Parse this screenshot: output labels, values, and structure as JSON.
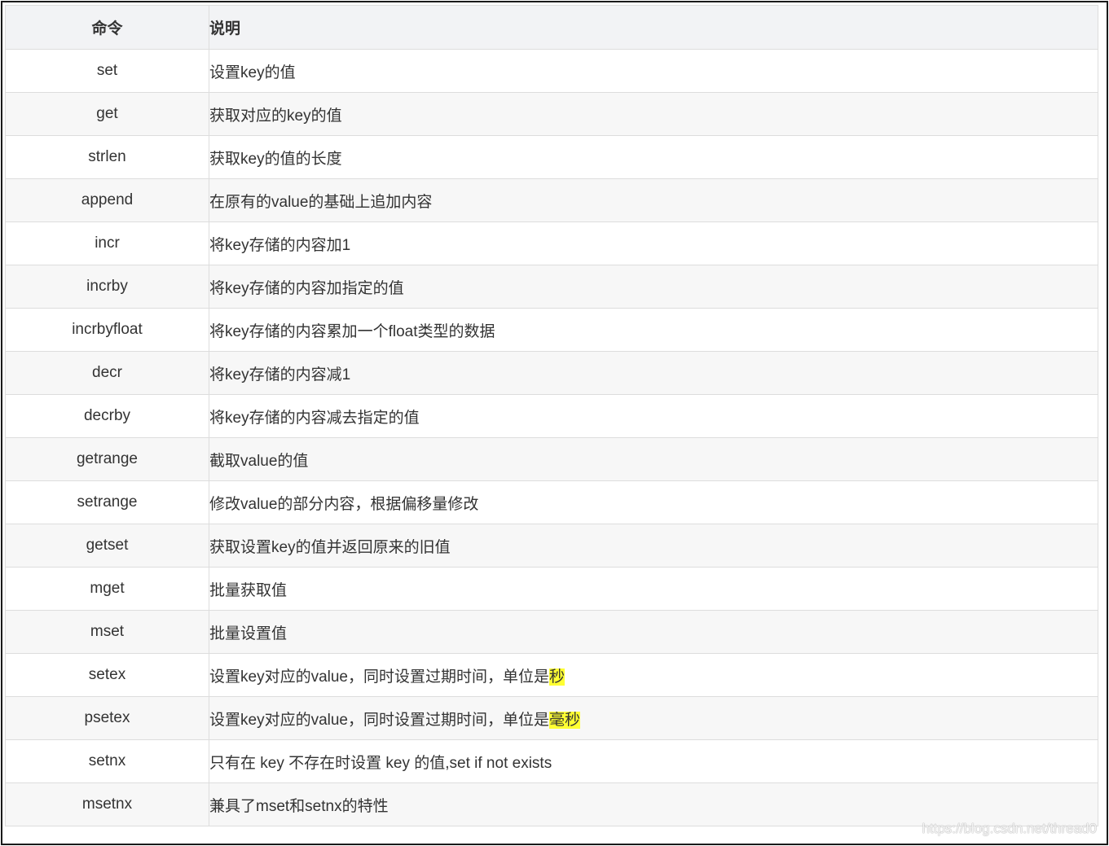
{
  "table": {
    "headers": {
      "command": "命令",
      "description": "说明"
    },
    "rows": [
      {
        "cmd": "set",
        "desc": "设置key的值",
        "hl": ""
      },
      {
        "cmd": "get",
        "desc": "获取对应的key的值",
        "hl": ""
      },
      {
        "cmd": "strlen",
        "desc": "获取key的值的长度",
        "hl": ""
      },
      {
        "cmd": "append",
        "desc": "在原有的value的基础上追加内容",
        "hl": ""
      },
      {
        "cmd": "incr",
        "desc": "将key存储的内容加1",
        "hl": ""
      },
      {
        "cmd": "incrby",
        "desc": "将key存储的内容加指定的值",
        "hl": ""
      },
      {
        "cmd": "incrbyfloat",
        "desc": "将key存储的内容累加一个float类型的数据",
        "hl": ""
      },
      {
        "cmd": "decr",
        "desc": "将key存储的内容减1",
        "hl": ""
      },
      {
        "cmd": "decrby",
        "desc": "将key存储的内容减去指定的值",
        "hl": ""
      },
      {
        "cmd": "getrange",
        "desc": "截取value的值",
        "hl": ""
      },
      {
        "cmd": "setrange",
        "desc": "修改value的部分内容，根据偏移量修改",
        "hl": ""
      },
      {
        "cmd": "getset",
        "desc": "获取设置key的值并返回原来的旧值",
        "hl": ""
      },
      {
        "cmd": "mget",
        "desc": "批量获取值",
        "hl": ""
      },
      {
        "cmd": "mset",
        "desc": "批量设置值",
        "hl": ""
      },
      {
        "cmd": "setex",
        "desc": "设置key对应的value，同时设置过期时间，单位是",
        "hl": "秒"
      },
      {
        "cmd": "psetex",
        "desc": "设置key对应的value，同时设置过期时间，单位是",
        "hl": "毫秒"
      },
      {
        "cmd": "setnx",
        "desc": "只有在 key 不存在时设置 key 的值,set if not exists",
        "hl": ""
      },
      {
        "cmd": "msetnx",
        "desc": "兼具了mset和setnx的特性",
        "hl": ""
      }
    ]
  },
  "watermark": "https://blog.csdn.net/thread0",
  "colors": {
    "header_bg": "#f2f3f5",
    "row_alt_bg": "#f7f7f7",
    "highlight": "#ffff33",
    "border": "#dddddd",
    "text": "#333333"
  }
}
